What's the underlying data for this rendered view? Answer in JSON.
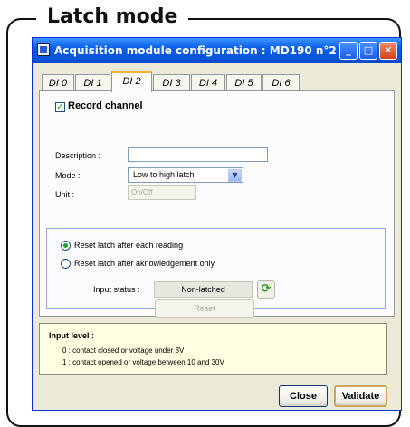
{
  "frame": {
    "title": "Latch mode"
  },
  "window": {
    "title": "Acquisition module configuration : MD190 n°2",
    "controls": {
      "minimize": "_",
      "maximize": "□",
      "close": "✕"
    }
  },
  "tabs": [
    {
      "label": "DI 0",
      "active": false
    },
    {
      "label": "DI 1",
      "active": false
    },
    {
      "label": "DI 2",
      "active": true
    },
    {
      "label": "DI 3",
      "active": false
    },
    {
      "label": "DI 4",
      "active": false
    },
    {
      "label": "DI 5",
      "active": false
    },
    {
      "label": "DI 6",
      "active": false
    }
  ],
  "channel": {
    "record_label": "Record channel",
    "record_checked": true,
    "description_label": "Description :",
    "description_value": "",
    "mode_label": "Mode :",
    "mode_value": "Low to high latch",
    "unit_label": "Unit :",
    "unit_value": "On/Off"
  },
  "latch": {
    "option_each_reading": "Reset latch after each reading",
    "option_acknowledgement": "Reset latch after aknowledgement only",
    "selected": "each_reading",
    "input_status_label": "Input status :",
    "input_status_value": "Non-latched",
    "reset_label": "Reset"
  },
  "info": {
    "title": "Input level :",
    "lines": [
      "0 : contact closed or voltage under 3V",
      "1 : contact opened or voltage between 10 and 30V"
    ]
  },
  "buttons": {
    "close": "Close",
    "validate": "Validate"
  }
}
